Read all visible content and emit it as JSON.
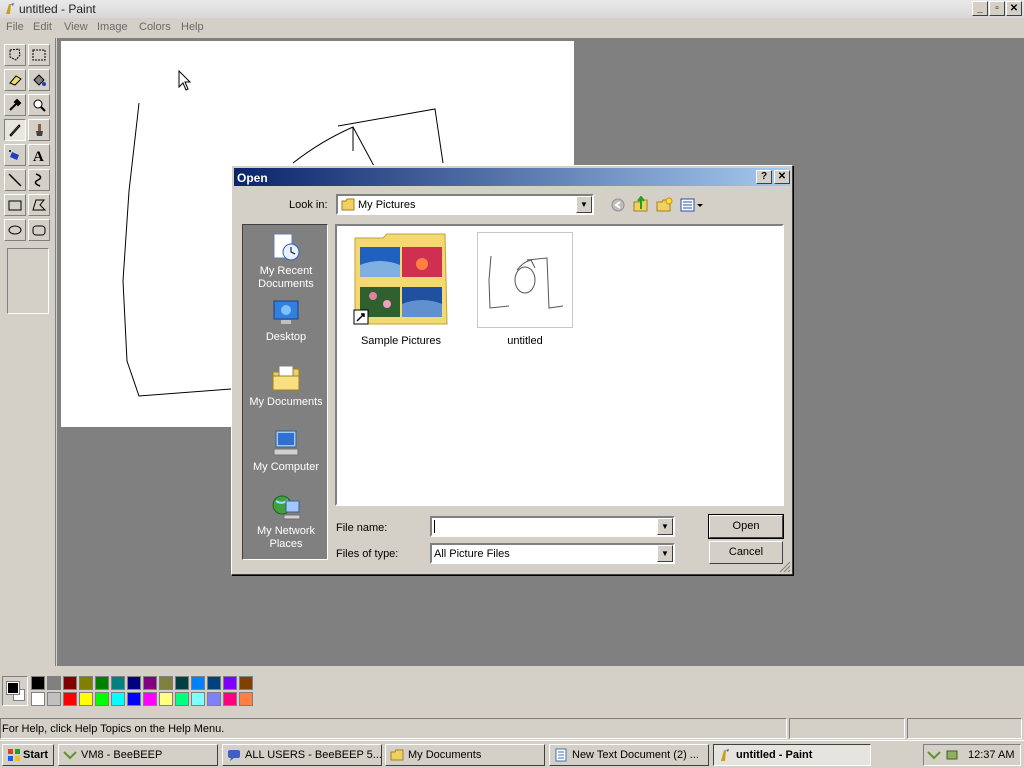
{
  "window": {
    "title": "untitled - Paint",
    "icon": "paint-brush-icon"
  },
  "menu": [
    "File",
    "Edit",
    "View",
    "Image",
    "Colors",
    "Help"
  ],
  "palette": {
    "row1": [
      "#000000",
      "#808080",
      "#800000",
      "#808000",
      "#008000",
      "#008080",
      "#000080",
      "#800080",
      "#808040",
      "#004040",
      "#0080ff",
      "#004080",
      "#8000ff",
      "#804000"
    ],
    "row2": [
      "#ffffff",
      "#c0c0c0",
      "#ff0000",
      "#ffff00",
      "#00ff00",
      "#00ffff",
      "#0000ff",
      "#ff00ff",
      "#ffff80",
      "#00ff80",
      "#80ffff",
      "#8080ff",
      "#ff0080",
      "#ff8040"
    ],
    "foreground": "#000000",
    "background": "#ffffff"
  },
  "status": {
    "help_text": "For Help, click Help Topics on the Help Menu."
  },
  "dialog": {
    "title": "Open",
    "look_in_label": "Look in:",
    "look_in_value": "My Pictures",
    "places": [
      "My Recent Documents",
      "Desktop",
      "My Documents",
      "My Computer",
      "My Network Places"
    ],
    "files": [
      {
        "name": "Sample Pictures",
        "type": "folder"
      },
      {
        "name": "untitled",
        "type": "image"
      }
    ],
    "file_name_label": "File name:",
    "file_name_value": "",
    "file_type_label": "Files of type:",
    "file_type_value": "All Picture Files",
    "open_label": "Open",
    "cancel_label": "Cancel"
  },
  "taskbar": {
    "start_label": "Start",
    "items": [
      "VM8 - BeeBEEP",
      "ALL USERS - BeeBEEP 5....",
      "My Documents",
      "New Text Document (2) ...",
      "untitled - Paint"
    ],
    "active_index": 4,
    "clock": "12:37 AM"
  }
}
